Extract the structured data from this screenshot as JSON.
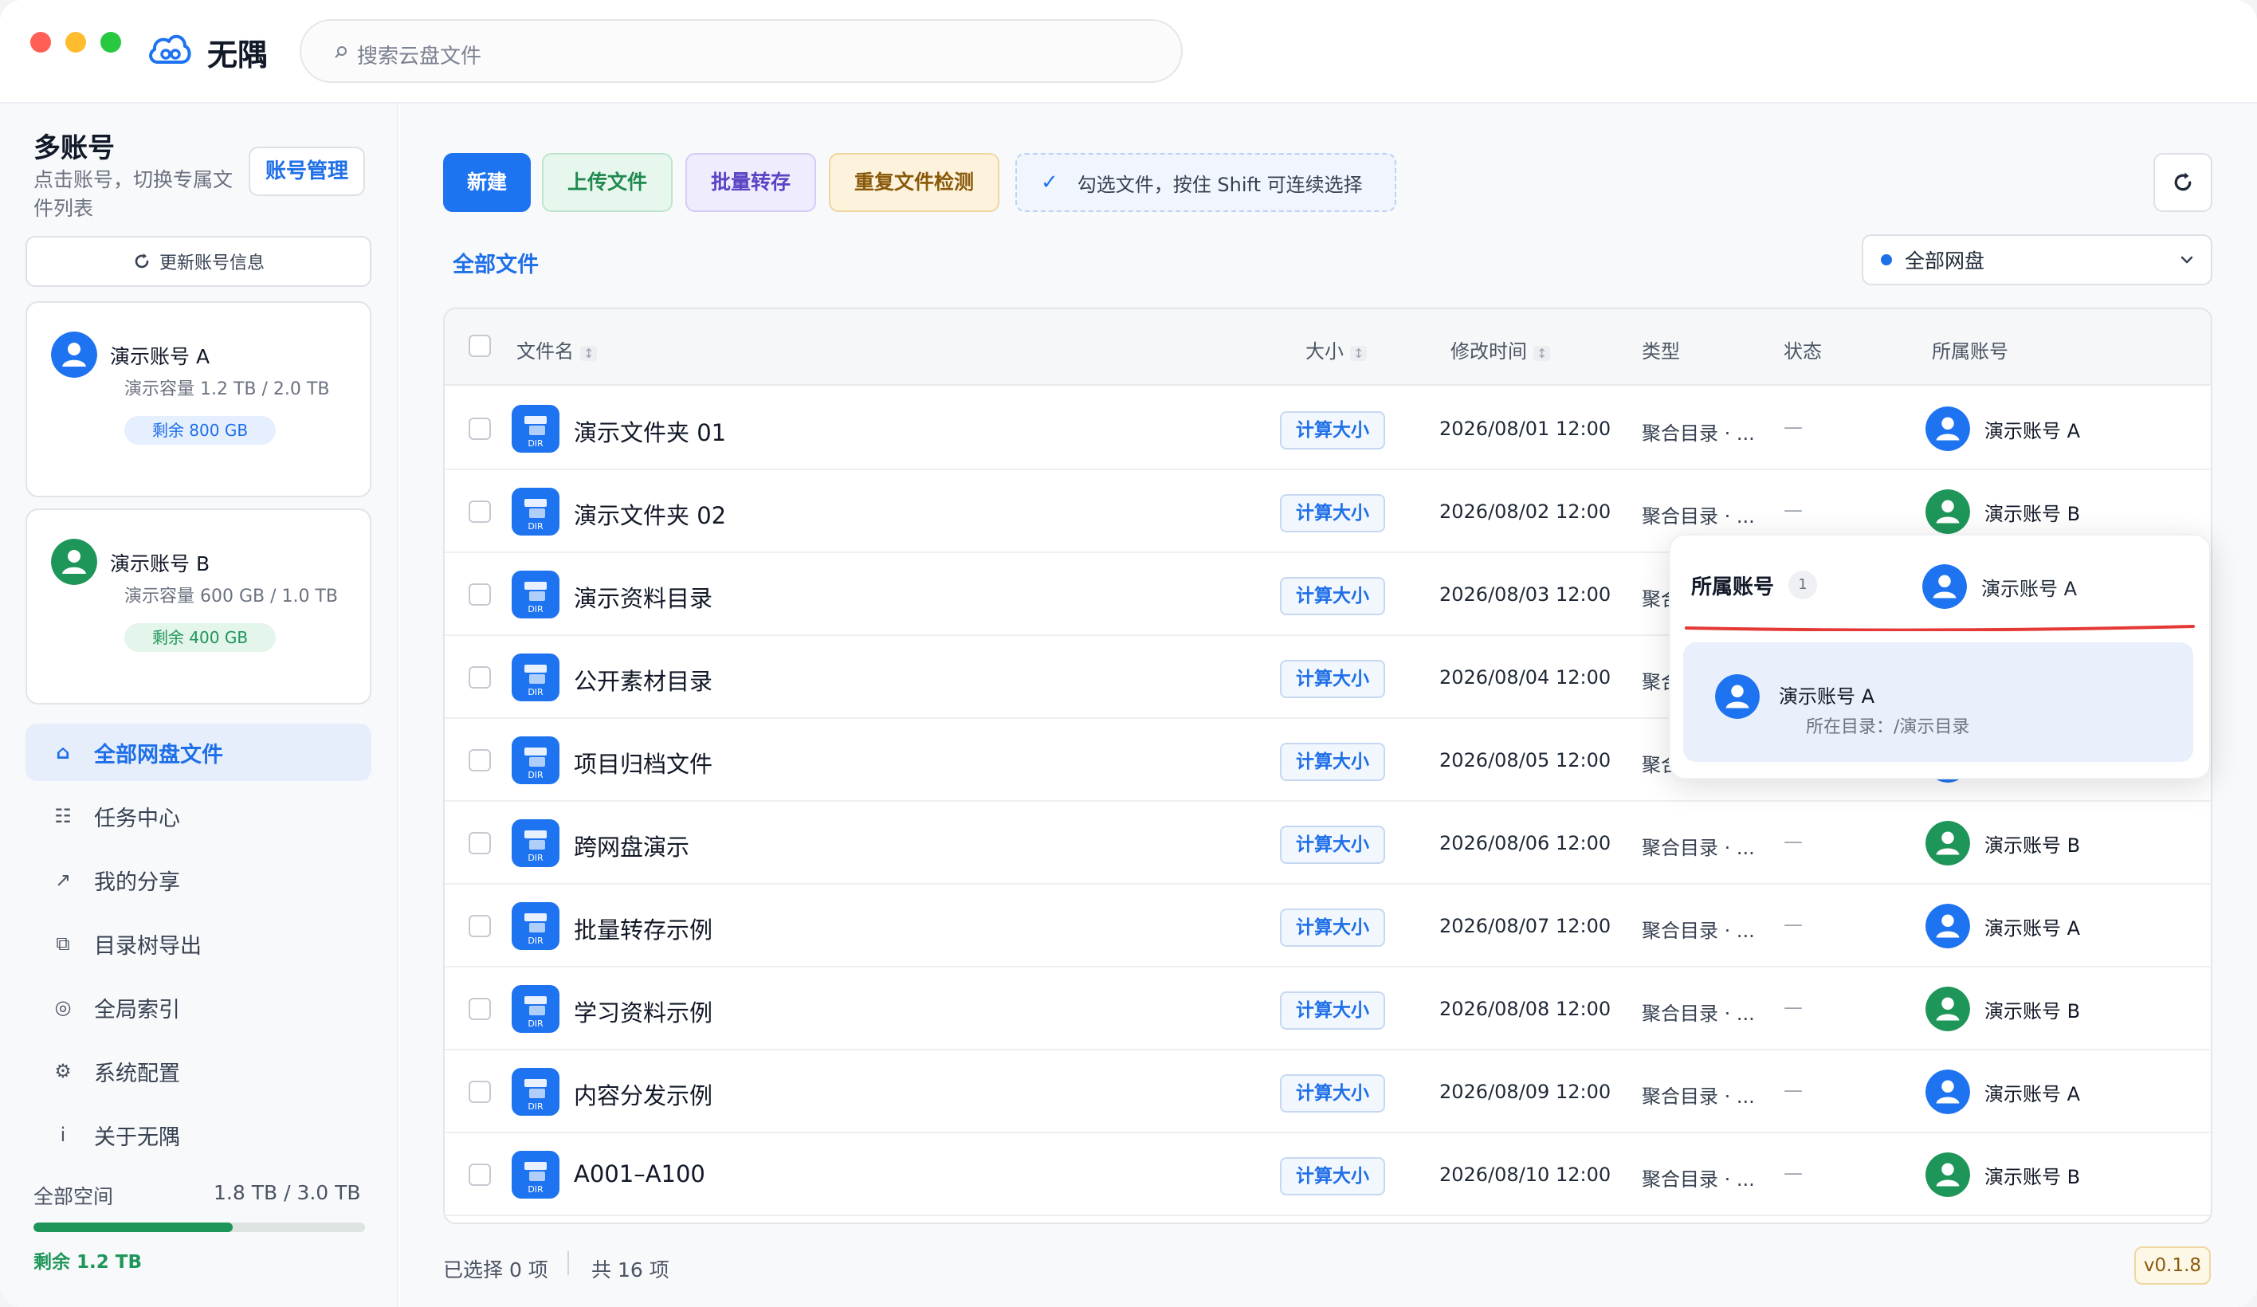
{
  "window": {
    "app_name": "无隅",
    "search_placeholder": "搜索云盘文件"
  },
  "sidebar": {
    "title": "多账号",
    "subtitle": "点击账号，切换专属文件列表",
    "account_manage_label": "账号管理",
    "refresh_info_label": "更新账号信息",
    "accounts": [
      {
        "name": "演示账号 A",
        "capacity": "演示容量 1.2 TB / 2.0 TB",
        "remaining": "剩余 800 GB",
        "color": "#1e73f0",
        "badge_bg": "#e6effd",
        "badge_fg": "#1e6fe8"
      },
      {
        "name": "演示账号 B",
        "capacity": "演示容量 600 GB / 1.0 TB",
        "remaining": "剩余 400 GB",
        "color": "#1e9659",
        "badge_bg": "#e4f5eb",
        "badge_fg": "#1e9659"
      }
    ],
    "nav": [
      {
        "label": "全部网盘文件",
        "icon": "home-icon",
        "glyph": "⌂",
        "active": true
      },
      {
        "label": "任务中心",
        "icon": "list-icon",
        "glyph": "☷",
        "active": false
      },
      {
        "label": "我的分享",
        "icon": "share-arrow-icon",
        "glyph": "↗",
        "active": false
      },
      {
        "label": "目录树导出",
        "icon": "tree-icon",
        "glyph": "⧉",
        "active": false
      },
      {
        "label": "全局索引",
        "icon": "index-icon",
        "glyph": "◎",
        "active": false
      },
      {
        "label": "系统配置",
        "icon": "gear-icon",
        "glyph": "⚙",
        "active": false
      },
      {
        "label": "关于无隅",
        "icon": "info-icon",
        "glyph": "i",
        "active": false
      }
    ],
    "storage": {
      "label": "全部空间",
      "value": "1.8 TB / 3.0 TB",
      "used_fraction": 0.6,
      "remaining": "剩余 1.2 TB"
    }
  },
  "toolbar": {
    "new_label": "新建",
    "upload_label": "上传文件",
    "batch_label": "批量转存",
    "dup_label": "重复文件检测",
    "hint": "勾选文件，按住 Shift 可连续选择"
  },
  "breadcrumb": "全部文件",
  "disk_filter": "全部网盘",
  "table": {
    "columns": {
      "name": "文件名",
      "size": "大小",
      "mtime": "修改时间",
      "type": "类型",
      "status": "状态",
      "account": "所属账号"
    },
    "size_button": "计算大小",
    "rows": [
      {
        "name": "演示文件夹 01",
        "mtime": "2026/08/01 12:00",
        "type": "聚合目录 · ...",
        "status": "—",
        "account": "演示账号 A",
        "color": "#1e73f0"
      },
      {
        "name": "演示文件夹 02",
        "mtime": "2026/08/02 12:00",
        "type": "聚合目录 · ...",
        "status": "—",
        "account": "演示账号 B",
        "color": "#1e9659"
      },
      {
        "name": "演示资料目录",
        "mtime": "2026/08/03 12:00",
        "type": "聚合目录 · ...",
        "status": "—",
        "account": "演示账号 A",
        "color": "#1e73f0"
      },
      {
        "name": "公开素材目录",
        "mtime": "2026/08/04 12:00",
        "type": "聚合目录 · ...",
        "status": "—",
        "account": "演示账号 B",
        "color": "#1e9659"
      },
      {
        "name": "项目归档文件",
        "mtime": "2026/08/05 12:00",
        "type": "聚合目录 · ...",
        "status": "—",
        "account": "演示账号 A",
        "color": "#1e73f0"
      },
      {
        "name": "跨网盘演示",
        "mtime": "2026/08/06 12:00",
        "type": "聚合目录 · ...",
        "status": "—",
        "account": "演示账号 B",
        "color": "#1e9659"
      },
      {
        "name": "批量转存示例",
        "mtime": "2026/08/07 12:00",
        "type": "聚合目录 · ...",
        "status": "—",
        "account": "演示账号 A",
        "color": "#1e73f0"
      },
      {
        "name": "学习资料示例",
        "mtime": "2026/08/08 12:00",
        "type": "聚合目录 · ...",
        "status": "—",
        "account": "演示账号 B",
        "color": "#1e9659"
      },
      {
        "name": "内容分发示例",
        "mtime": "2026/08/09 12:00",
        "type": "聚合目录 · ...",
        "status": "—",
        "account": "演示账号 A",
        "color": "#1e73f0"
      },
      {
        "name": "A001–A100",
        "mtime": "2026/08/10 12:00",
        "type": "聚合目录 · ...",
        "status": "—",
        "account": "演示账号 B",
        "color": "#1e9659"
      }
    ]
  },
  "footer": {
    "selected": "已选择 0 项",
    "total": "共 16 项",
    "version": "v0.1.8"
  },
  "popover": {
    "title": "所属账号",
    "count": "1",
    "account": "演示账号 A",
    "item_name": "演示账号 A",
    "item_path": "所在目录：/演示目录",
    "color": "#1e73f0",
    "underline_color": "#e53935"
  }
}
